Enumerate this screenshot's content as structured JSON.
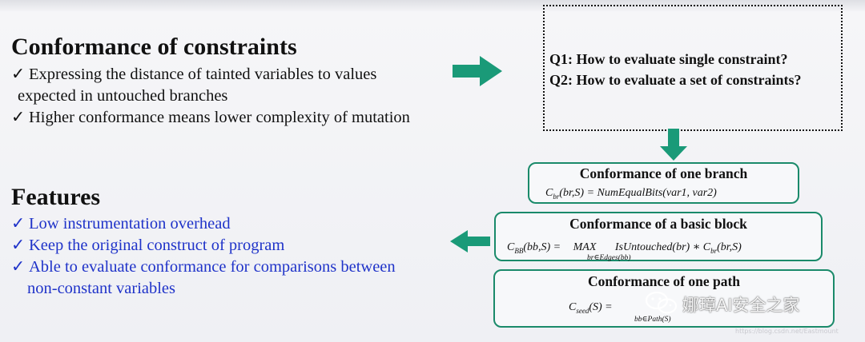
{
  "conformance": {
    "title": "Conformance of constraints",
    "bullets": [
      "Expressing the distance of tainted variables to values",
      "expected in untouched branches",
      "Higher conformance means lower complexity of mutation"
    ]
  },
  "questions": {
    "q1": "Q1: How to evaluate single constraint?",
    "q2": "Q2: How to evaluate a set of constraints?"
  },
  "features": {
    "title": "Features",
    "bullets": [
      "Low instrumentation overhead",
      "Keep the original construct of program",
      "Able to evaluate conformance for comparisons between",
      "non-constant variables"
    ]
  },
  "boxes": {
    "branch": {
      "title": "Conformance of one branch",
      "formula_lhs": "C",
      "formula_sub": "br",
      "formula_rhs": "(br,S) = NumEqualBits(var1, var2)"
    },
    "block": {
      "title": "Conformance of a basic block",
      "formula_lhs": "C",
      "formula_sub": "BB",
      "formula_mid": "(bb,S) =",
      "max": "MAX",
      "max_sub": "br∈Edges(bb)",
      "formula_rhs": "IsUntouched(br) ∗ C",
      "rhs_sub": "br",
      "formula_end": "(br,S)"
    },
    "path": {
      "title": "Conformance of one path",
      "formula_lhs": "C",
      "formula_sub": "seed",
      "formula_mid": "(S) =",
      "sum_sub": "bb∈Path(S)"
    }
  },
  "watermark": "娜璋AI安全之家",
  "url": "https://blog.csdn.net/Eastmount",
  "colors": {
    "arrow": "#1a9a78",
    "box_border": "#1a8a6a",
    "features_text": "#1f33c9"
  },
  "icons": [
    "checkmark-icon",
    "arrow-right-icon",
    "arrow-down-icon",
    "arrow-left-icon",
    "wechat-icon"
  ]
}
